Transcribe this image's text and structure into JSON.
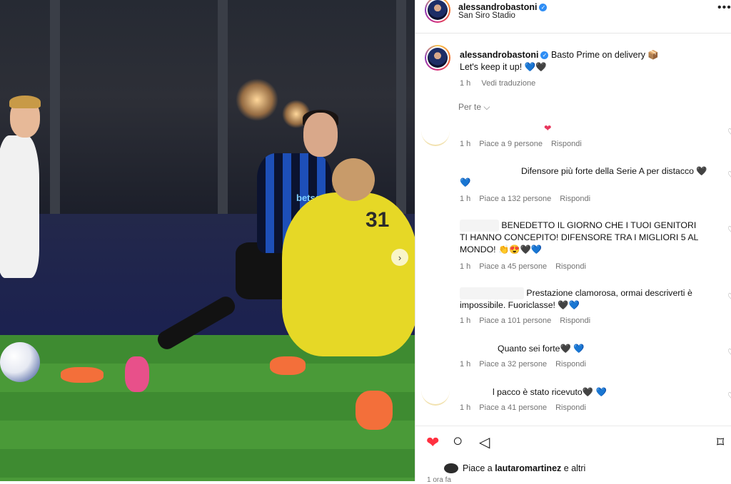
{
  "post": {
    "username": "alessandrobastoni",
    "location": "San Siro Stadio",
    "more_label": "•••",
    "next_label": "›",
    "caption_line1": "Basto Prime on delivery 📦",
    "caption_line2": "Let's keep it up! 💙🖤",
    "caption_time": "1 h",
    "caption_translate": "Vedi traduzione",
    "sort_label": "Per te ⌵",
    "jersey_number": "31",
    "sponsor": "betsson"
  },
  "comments": [
    {
      "text": "❤",
      "time": "1 h",
      "likes": "Piace a 9 persone",
      "reply": "Rispondi"
    },
    {
      "text": "Difensore più forte della Serie A per distacco 🖤",
      "text2": "💙",
      "time": "1 h",
      "likes": "Piace a 132 persone",
      "reply": "Rispondi"
    },
    {
      "text": "BENEDETTO IL GIORNO CHE I TUOI GENITORI TI HANNO CONCEPITO! DIFENSORE TRA I MIGLIORI 5 AL MONDO! 👏😍🖤💙",
      "time": "1 h",
      "likes": "Piace a 45 persone",
      "reply": "Rispondi"
    },
    {
      "text": "Prestazione clamorosa, ormai descriverti è impossibile. Fuoriclasse! 🖤💙",
      "time": "1 h",
      "likes": "Piace a 101 persone",
      "reply": "Rispondi"
    },
    {
      "text": "Quanto sei forte🖤 💙",
      "time": "1 h",
      "likes": "Piace a 32 persone",
      "reply": "Rispondi"
    },
    {
      "text": "l pacco è stato ricevuto🖤 💙",
      "time": "1 h",
      "likes": "Piace a 41 persone",
      "reply": "Rispondi"
    }
  ],
  "actions": {
    "liked_by_prefix": "Piace a",
    "liked_by_user": "lautaromartinez",
    "liked_by_suffix": "e altri",
    "time_ago": "1 ora fa"
  },
  "colors": {
    "like_red": "#ff3040",
    "verified_blue": "#2f8ef5"
  }
}
